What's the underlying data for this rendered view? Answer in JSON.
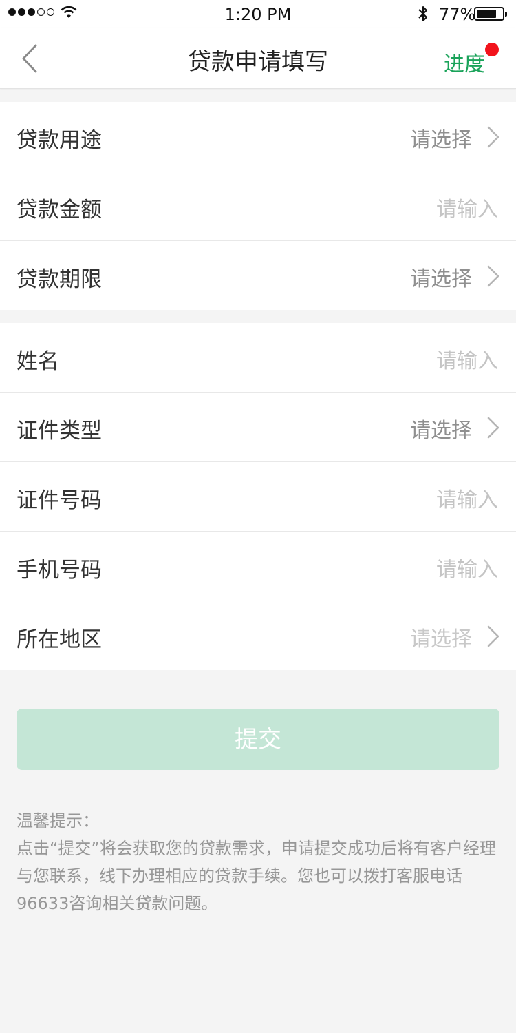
{
  "status_bar": {
    "time": "1:20 PM",
    "battery_percent": "77%",
    "battery_level": 0.77,
    "signal_bars_filled": 3,
    "signal_bars_total": 5
  },
  "nav": {
    "title": "贷款申请填写",
    "back_icon": "chevron-left-icon",
    "progress_label": "进度",
    "badge_color": "#f2131c",
    "accent_color": "#1aa35a"
  },
  "form": {
    "group1": [
      {
        "label": "贷款用途",
        "value": "请选择",
        "type": "select"
      },
      {
        "label": "贷款金额",
        "value": "请输入",
        "type": "input"
      },
      {
        "label": "贷款期限",
        "value": "请选择",
        "type": "select"
      }
    ],
    "group2": [
      {
        "label": "姓名",
        "value": "请输入",
        "type": "input"
      },
      {
        "label": "证件类型",
        "value": "请选择",
        "type": "select"
      },
      {
        "label": "证件号码",
        "value": "请输入",
        "type": "input"
      },
      {
        "label": "手机号码",
        "value": "请输入",
        "type": "input"
      },
      {
        "label": "所在地区",
        "value": "请选择",
        "type": "select"
      }
    ]
  },
  "submit": {
    "label": "提交",
    "color": "#c4e6d6"
  },
  "tips": {
    "title": "温馨提示：",
    "body": "点击“提交”将会获取您的贷款需求，申请提交成功后将有客户经理与您联系，线下办理相应的贷款手续。您也可以拨打客服电话96633咨询相关贷款问题。"
  }
}
